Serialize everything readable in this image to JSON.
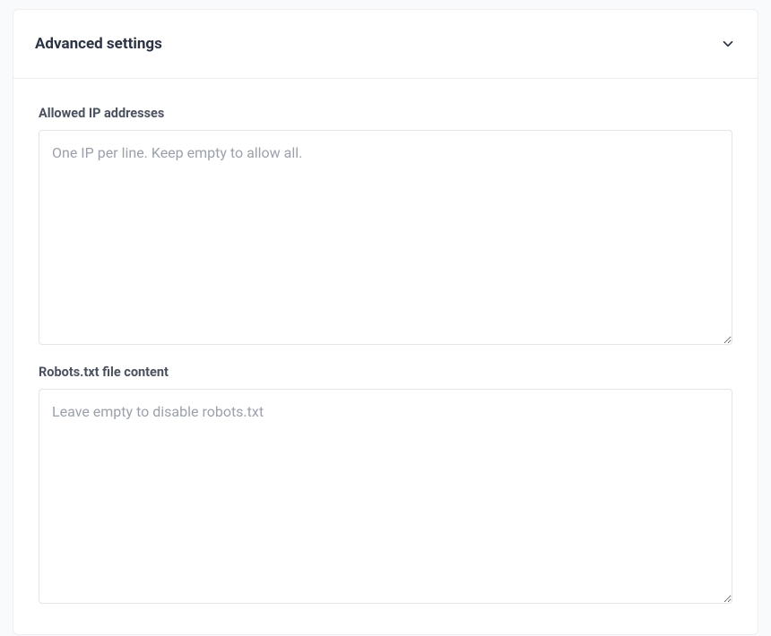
{
  "panel": {
    "title": "Advanced settings"
  },
  "fields": {
    "allowed_ips": {
      "label": "Allowed IP addresses",
      "placeholder": "One IP per line. Keep empty to allow all.",
      "value": ""
    },
    "robots_txt": {
      "label": "Robots.txt file content",
      "placeholder": "Leave empty to disable robots.txt",
      "value": ""
    }
  }
}
